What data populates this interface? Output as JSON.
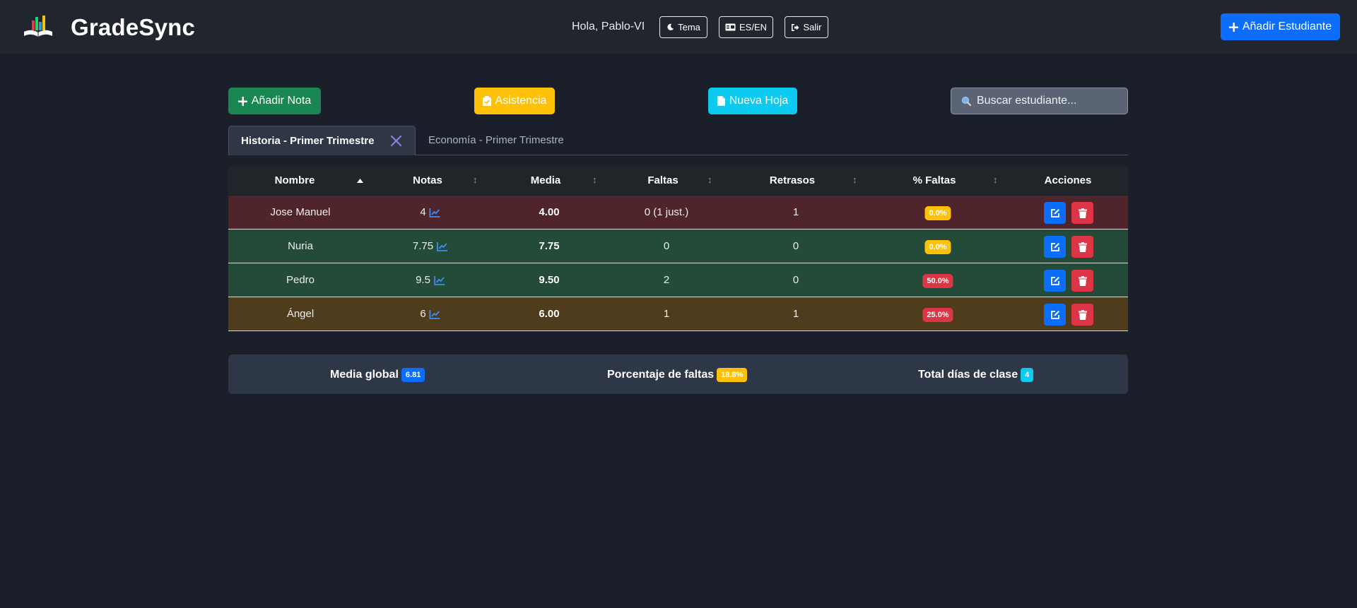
{
  "header": {
    "app_name": "GradeSync",
    "greeting": "Hola, Pablo-VI",
    "theme_label": "Tema",
    "lang_label": "ES/EN",
    "logout_label": "Salir",
    "add_student_label": "Añadir Estudiante"
  },
  "toolbar": {
    "add_grade_label": "Añadir Nota",
    "attendance_label": "Asistencia",
    "new_sheet_label": "Nueva Hoja",
    "search_placeholder": "Buscar estudiante..."
  },
  "tabs": [
    {
      "label": "Historia - Primer Trimestre",
      "active": true
    },
    {
      "label": "Economía - Primer Trimestre",
      "active": false
    }
  ],
  "table": {
    "headers": [
      "Nombre",
      "Notas",
      "Media",
      "Faltas",
      "Retrasos",
      "% Faltas",
      "Acciones"
    ],
    "rows": [
      {
        "name": "Jose Manuel",
        "grades": "4",
        "average": "4.00",
        "absences": "0 (1 just.)",
        "delays": "1",
        "absence_pct": "0.0%",
        "status": "danger",
        "pct_level": "warning"
      },
      {
        "name": "Nuria",
        "grades": "7.75",
        "average": "7.75",
        "absences": "0",
        "delays": "0",
        "absence_pct": "0.0%",
        "status": "success",
        "pct_level": "warning"
      },
      {
        "name": "Pedro",
        "grades": "9.5",
        "average": "9.50",
        "absences": "2",
        "delays": "0",
        "absence_pct": "50.0%",
        "status": "success",
        "pct_level": "danger"
      },
      {
        "name": "Ángel",
        "grades": "6",
        "average": "6.00",
        "absences": "1",
        "delays": "1",
        "absence_pct": "25.0%",
        "status": "warning",
        "pct_level": "danger"
      }
    ]
  },
  "stats": {
    "global_average_label": "Media global",
    "global_average_value": "6.81",
    "absence_pct_label": "Porcentaje de faltas",
    "absence_pct_value": "18.8%",
    "total_days_label": "Total días de clase",
    "total_days_value": "4"
  },
  "colors": {
    "primary": "#0d6efd",
    "success": "#198754",
    "warning": "#ffc107",
    "info": "#0dcaf0",
    "danger": "#dc3545",
    "row_danger": "#4f242b",
    "row_success": "#244b38",
    "row_warning": "#4f3c1d"
  },
  "icons": {
    "logo": "book-chart-logo",
    "theme": "moon-icon",
    "lang": "language-icon",
    "logout": "sign-out-icon",
    "add": "plus-icon",
    "attendance": "clipboard-check-icon",
    "new_sheet": "file-icon",
    "search": "search-icon",
    "close_tab": "close-icon",
    "sort": "sort-icon",
    "chart": "chart-line-icon",
    "edit": "edit-icon",
    "delete": "trash-icon"
  }
}
